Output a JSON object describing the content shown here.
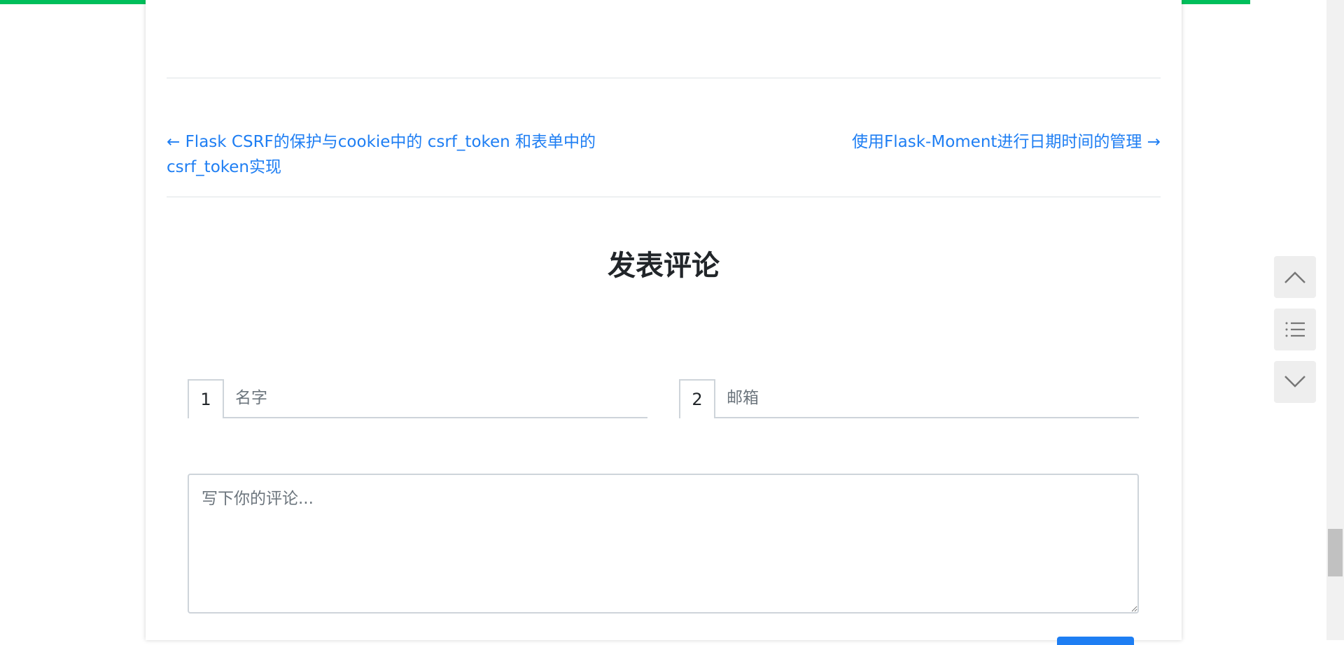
{
  "colors": {
    "progress": "#00bf5b",
    "link": "#1e7ef3",
    "text": "#212529",
    "placeholder": "#6c757d",
    "border": "#ced4da"
  },
  "reading_progress": 0.93,
  "post_nav": {
    "prev_label": "← Flask CSRF的保护与cookie中的 csrf_token 和表单中的 csrf_token实现",
    "next_label": "使用Flask-Moment进行日期时间的管理 →"
  },
  "comment_form": {
    "title": "发表评论",
    "name_prefix": "1",
    "name_placeholder": "名字",
    "email_prefix": "2",
    "email_placeholder": "邮箱",
    "comment_placeholder": "写下你的评论..."
  },
  "floating_buttons": {
    "top_icon": "chevron-up-icon",
    "toc_icon": "list-icon",
    "bottom_icon": "chevron-down-icon"
  }
}
